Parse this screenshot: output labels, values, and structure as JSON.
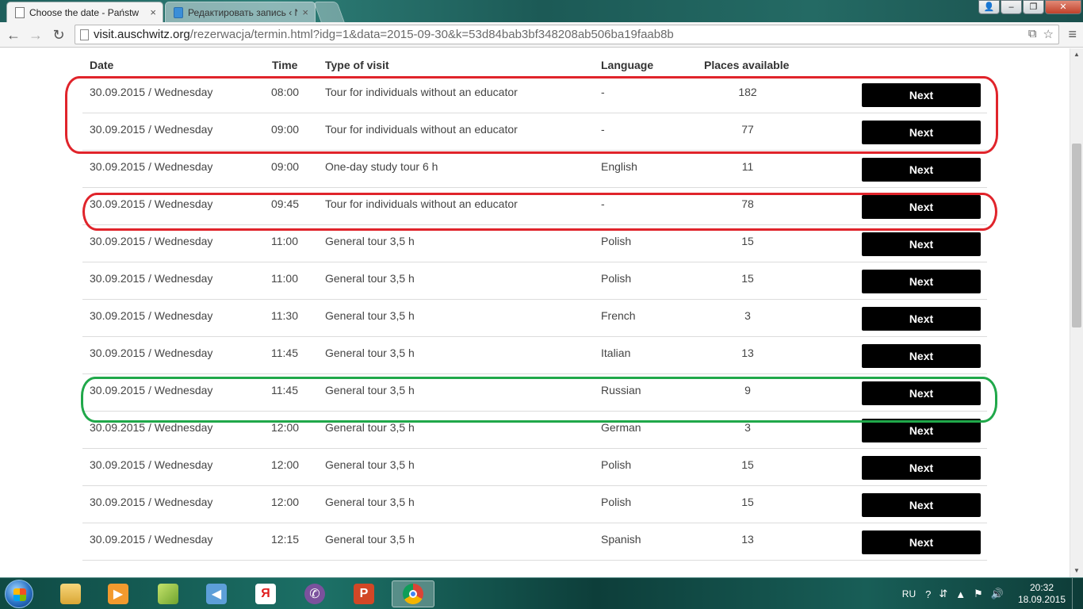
{
  "browser": {
    "tabs": [
      {
        "title": "Choose the date - Państw",
        "close": "×"
      },
      {
        "title": "Редактировать запись ‹ N",
        "close": "×"
      }
    ],
    "window_buttons": {
      "user": "👤",
      "minimize": "–",
      "maximize": "❐",
      "close": "✕"
    },
    "nav": {
      "back": "←",
      "forward": "→",
      "reload": "↻"
    },
    "url": {
      "host": "visit.auschwitz.org",
      "path": "/rezerwacja/termin.html?idg=1&data=2015-09-30&k=53d84bab3bf348208ab506ba19faab8b"
    },
    "menu": "≡"
  },
  "table": {
    "headers": {
      "date": "Date",
      "time": "Time",
      "type": "Type of visit",
      "language": "Language",
      "places": "Places available"
    },
    "rows": [
      {
        "date": "30.09.2015 / Wednesday",
        "time": "08:00",
        "type": "Tour for individuals without an educator",
        "language": "-",
        "places": "182",
        "button": "Next"
      },
      {
        "date": "30.09.2015 / Wednesday",
        "time": "09:00",
        "type": "Tour for individuals without an educator",
        "language": "-",
        "places": "77",
        "button": "Next"
      },
      {
        "date": "30.09.2015 / Wednesday",
        "time": "09:00",
        "type": "One-day study tour 6 h",
        "language": "English",
        "places": "11",
        "button": "Next"
      },
      {
        "date": "30.09.2015 / Wednesday",
        "time": "09:45",
        "type": "Tour for individuals without an educator",
        "language": "-",
        "places": "78",
        "button": "Next"
      },
      {
        "date": "30.09.2015 / Wednesday",
        "time": "11:00",
        "type": "General tour 3,5 h",
        "language": "Polish",
        "places": "15",
        "button": "Next"
      },
      {
        "date": "30.09.2015 / Wednesday",
        "time": "11:00",
        "type": "General tour 3,5 h",
        "language": "Polish",
        "places": "15",
        "button": "Next"
      },
      {
        "date": "30.09.2015 / Wednesday",
        "time": "11:30",
        "type": "General tour 3,5 h",
        "language": "French",
        "places": "3",
        "button": "Next"
      },
      {
        "date": "30.09.2015 / Wednesday",
        "time": "11:45",
        "type": "General tour 3,5 h",
        "language": "Italian",
        "places": "13",
        "button": "Next"
      },
      {
        "date": "30.09.2015 / Wednesday",
        "time": "11:45",
        "type": "General tour 3,5 h",
        "language": "Russian",
        "places": "9",
        "button": "Next"
      },
      {
        "date": "30.09.2015 / Wednesday",
        "time": "12:00",
        "type": "General tour 3,5 h",
        "language": "German",
        "places": "3",
        "button": "Next"
      },
      {
        "date": "30.09.2015 / Wednesday",
        "time": "12:00",
        "type": "General tour 3,5 h",
        "language": "Polish",
        "places": "15",
        "button": "Next"
      },
      {
        "date": "30.09.2015 / Wednesday",
        "time": "12:00",
        "type": "General tour 3,5 h",
        "language": "Polish",
        "places": "15",
        "button": "Next"
      },
      {
        "date": "30.09.2015 / Wednesday",
        "time": "12:15",
        "type": "General tour 3,5 h",
        "language": "Spanish",
        "places": "13",
        "button": "Next"
      }
    ]
  },
  "annotation_colors": {
    "highlight_red": "#e0242b",
    "highlight_green": "#20a84a"
  },
  "taskbar": {
    "icons": [
      "explorer-icon",
      "media-player-icon",
      "windows-photo-icon",
      "speaker-icon",
      "yandex-icon",
      "viber-icon",
      "powerpoint-icon",
      "chrome-icon"
    ],
    "tray": {
      "language": "RU",
      "help": "?",
      "time": "20:32",
      "date": "18.09.2015"
    }
  }
}
